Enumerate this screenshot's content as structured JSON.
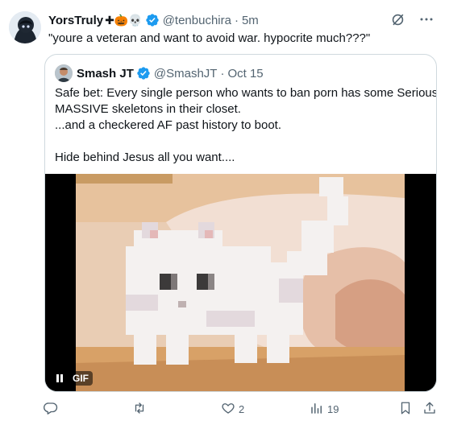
{
  "tweet": {
    "author_name": "YorsTruly",
    "author_emojis": "✚🎃💀",
    "handle": "@tenbuchira",
    "separator": "·",
    "time": "5m",
    "text": "\"youre a veteran and want to avoid war. hypocrite much???\""
  },
  "quote": {
    "author_name": "Smash JT",
    "handle": "@SmashJT",
    "separator": "·",
    "date": "Oct 15",
    "lines": [
      "Safe bet: Every single person who wants to ban porn has some Serious",
      "MASSIVE skeletons in their closet.",
      "...and a checkered AF past history to boot.",
      "",
      "Hide behind Jesus all you want...."
    ],
    "media": {
      "type": "gif",
      "badge": "GIF",
      "playing": true
    }
  },
  "actions": {
    "reply_count": "",
    "retweet_count": "",
    "like_count": "2",
    "views_count": "19"
  },
  "colors": {
    "text": "#0f1419",
    "secondary": "#536471",
    "verified": "#1d9bf0",
    "border": "#cfd9de"
  },
  "icons": [
    "grok-icon",
    "more-icon",
    "verified-icon",
    "reply-icon",
    "retweet-icon",
    "like-icon",
    "views-icon",
    "bookmark-icon",
    "share-icon",
    "pause-icon"
  ]
}
